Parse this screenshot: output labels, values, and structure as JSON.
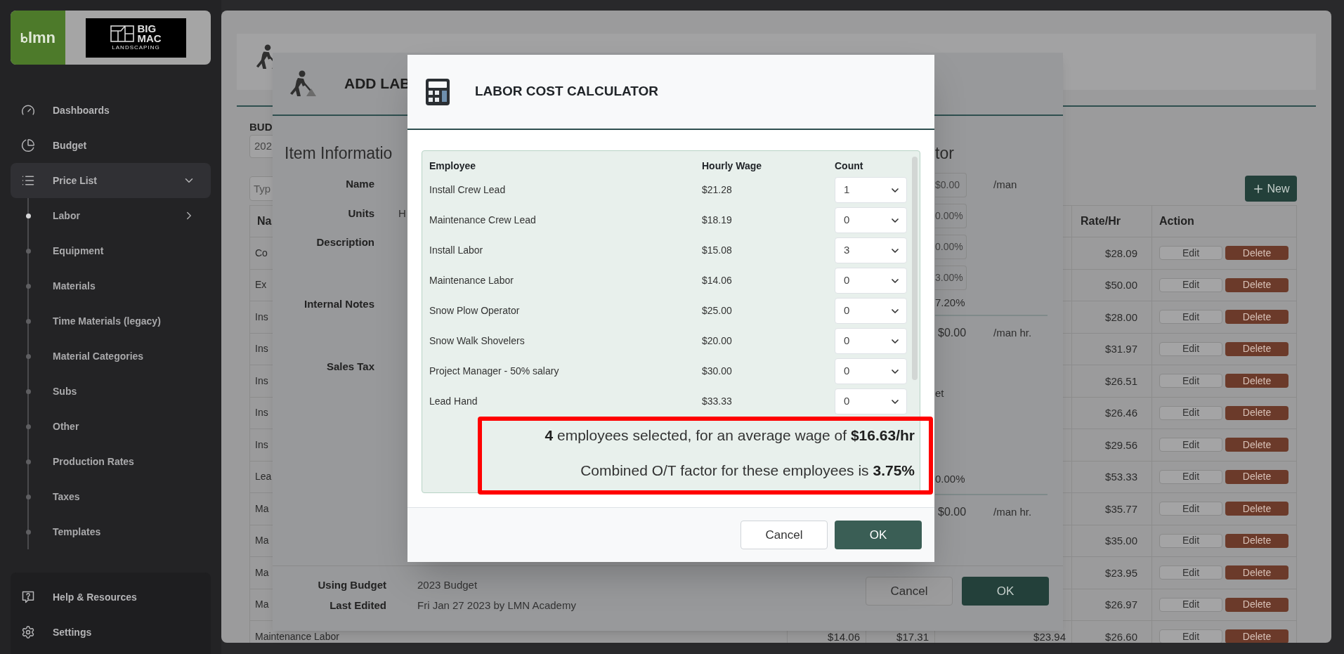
{
  "sidebar": {
    "logo": {
      "brand": "lmn",
      "company": [
        "BIG",
        "MAC"
      ],
      "company_tagline": "LANDSCAPING"
    },
    "items": [
      {
        "label": "Dashboards",
        "selected": false
      },
      {
        "label": "Budget",
        "selected": false
      },
      {
        "label": "Price List",
        "selected": true,
        "expanded": true,
        "children": [
          {
            "label": "Labor",
            "selected": true,
            "expanded": false
          },
          {
            "label": "Equipment",
            "selected": false
          },
          {
            "label": "Materials",
            "selected": false
          },
          {
            "label": "Time Materials (legacy)",
            "selected": false
          },
          {
            "label": "Material Categories",
            "selected": false
          },
          {
            "label": "Subs",
            "selected": false
          },
          {
            "label": "Other",
            "selected": false
          },
          {
            "label": "Production Rates",
            "selected": false
          },
          {
            "label": "Taxes",
            "selected": false
          },
          {
            "label": "Templates",
            "selected": false
          }
        ]
      }
    ],
    "footer_items": [
      {
        "label": "Help & Resources"
      },
      {
        "label": "Settings"
      }
    ]
  },
  "labor_catalog": {
    "budget_label": "BUD",
    "budget_value": "202",
    "search_placeholder": "Typ",
    "new_button": "New",
    "table": {
      "columns": [
        "Na",
        "Rate/Hr",
        "Action"
      ],
      "rows": [
        {
          "name": "Co",
          "rate": "$28.09",
          "actions": [
            "Edit",
            "Delete"
          ]
        },
        {
          "name": "Ex",
          "rate": "$50.00",
          "actions": [
            "Edit",
            "Delete"
          ]
        },
        {
          "name": "Ins",
          "rate": "$28.00",
          "actions": [
            "Edit",
            "Delete"
          ]
        },
        {
          "name": "Ins",
          "rate": "$31.97",
          "actions": [
            "Edit",
            "Delete"
          ]
        },
        {
          "name": "Ins",
          "rate": "$26.51",
          "actions": [
            "Edit",
            "Delete"
          ]
        },
        {
          "name": "Ins",
          "rate": "$26.46",
          "actions": [
            "Edit",
            "Delete"
          ]
        },
        {
          "name": "Ins",
          "rate": "$29.56",
          "actions": [
            "Edit",
            "Delete"
          ]
        },
        {
          "name": "Lea",
          "rate": "$53.33",
          "actions": [
            "Edit",
            "Delete"
          ]
        },
        {
          "name": "Ma",
          "rate": "$35.77",
          "actions": [
            "Edit",
            "Delete"
          ]
        },
        {
          "name": "Ma",
          "rate": "$35.00",
          "actions": [
            "Edit",
            "Delete"
          ]
        },
        {
          "name": "Ma",
          "rate": "$23.95",
          "actions": [
            "Edit",
            "Delete"
          ]
        },
        {
          "name": "Ma",
          "rate": "$26.97",
          "actions": [
            "Edit",
            "Delete"
          ]
        },
        {
          "name": "Maintenance Labor",
          "column_2": "$14.06",
          "column_3": "$17.31",
          "column_4": "$23.94",
          "rate": "$26.60",
          "actions": [
            "Edit",
            "Delete"
          ]
        }
      ]
    }
  },
  "add_labor_dialog": {
    "title": "ADD LAB",
    "section_title": "Item Informatio",
    "fields": [
      {
        "label": "Name"
      },
      {
        "label": "Units",
        "value": "H"
      },
      {
        "label": "Description"
      },
      {
        "label": "Internal Notes"
      },
      {
        "label": "Sales Tax"
      }
    ],
    "right_panel": {
      "heading": "tor",
      "items": [
        {
          "kind": "input",
          "value": "$0.00",
          "unit": "/man"
        },
        {
          "kind": "input",
          "value": "0.00%"
        },
        {
          "kind": "input",
          "value": "0.00%"
        },
        {
          "kind": "input",
          "value": "3.00%"
        },
        {
          "kind": "text",
          "value": "7.20%"
        },
        {
          "kind": "total",
          "value": "$0.00",
          "unit": "/man hr."
        },
        {
          "kind": "text",
          "value": "et"
        },
        {
          "kind": "text",
          "value": "0.00%"
        },
        {
          "kind": "total",
          "value": "$0.00",
          "unit": "/man hr."
        }
      ]
    },
    "footer": {
      "info": [
        {
          "label": "Using Budget",
          "value": "2023 Budget"
        },
        {
          "label": "Last Edited",
          "value": "Fri Jan 27 2023 by LMN Academy"
        }
      ],
      "buttons": [
        {
          "label": "Cancel",
          "kind": "secondary"
        },
        {
          "label": "OK",
          "kind": "primary"
        }
      ]
    }
  },
  "labor_cost_calculator": {
    "title": "LABOR COST CALCULATOR",
    "columns": [
      "Employee",
      "Hourly Wage",
      "Count"
    ],
    "employees": [
      {
        "name": "Install Crew Lead",
        "wage": "$21.28",
        "count": "1"
      },
      {
        "name": "Maintenance Crew Lead",
        "wage": "$18.19",
        "count": "0"
      },
      {
        "name": "Install Labor",
        "wage": "$15.08",
        "count": "3"
      },
      {
        "name": "Maintenance Labor",
        "wage": "$14.06",
        "count": "0"
      },
      {
        "name": "Snow Plow Operator",
        "wage": "$25.00",
        "count": "0"
      },
      {
        "name": "Snow Walk Shovelers",
        "wage": "$20.00",
        "count": "0"
      },
      {
        "name": "Project Manager - 50% salary",
        "wage": "$30.00",
        "count": "0"
      },
      {
        "name": "Lead Hand",
        "wage": "$33.33",
        "count": "0"
      }
    ],
    "summary": [
      "**4** employees selected, for an average wage of **$16.63/hr**",
      "Combined O/T factor for these employees is **3.75%**"
    ],
    "buttons": [
      {
        "label": "Cancel",
        "kind": "secondary"
      },
      {
        "label": "OK",
        "kind": "primary"
      }
    ]
  }
}
